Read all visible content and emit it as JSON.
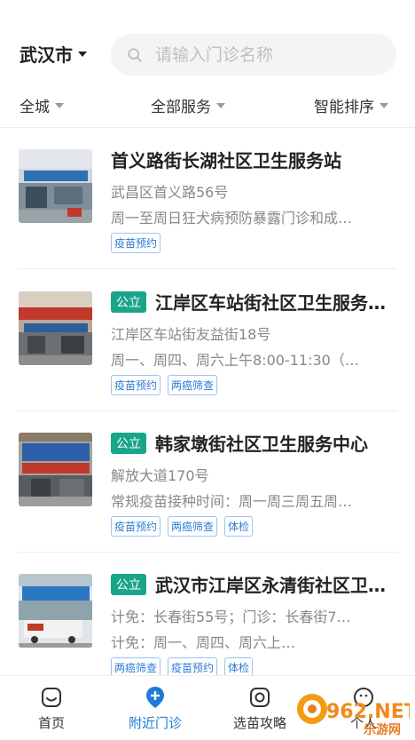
{
  "header": {
    "city": "武汉市",
    "search_placeholder": "请输入门诊名称"
  },
  "filters": {
    "area": "全城",
    "service": "全部服务",
    "sort": "智能排序"
  },
  "clinics": [
    {
      "public_badge": "",
      "name": "首义路街长湖社区卫生服务站",
      "address": "武昌区首义路56号",
      "hours": "周一至周日狂犬病预防暴露门诊和成…",
      "tags": [
        "疫苗预约"
      ]
    },
    {
      "public_badge": "公立",
      "name": "江岸区车站街社区卫生服务…",
      "address": "江岸区车站街友益街18号",
      "hours": "周一、周四、周六上午8:00-11:30（…",
      "tags": [
        "疫苗预约",
        "两癌筛查"
      ]
    },
    {
      "public_badge": "公立",
      "name": "韩家墩街社区卫生服务中心",
      "address": "解放大道170号",
      "hours": "常规疫苗接种时间：周一周三周五周…",
      "tags": [
        "疫苗预约",
        "两癌筛查",
        "体检"
      ]
    },
    {
      "public_badge": "公立",
      "name": "武汉市江岸区永清街社区卫…",
      "address": "计免：长春街55号；门诊：长春街7…",
      "hours": "计免：周一、周四、周六上…",
      "tags": [
        "两癌筛查",
        "疫苗预约",
        "体检"
      ]
    }
  ],
  "tabbar": {
    "home": "首页",
    "nearby": "附近门诊",
    "guide": "选苗攻略",
    "mine": "个人"
  },
  "watermark": {
    "brand": "962.NET",
    "sub": "乐游网"
  },
  "colors": {
    "accent_blue": "#1f7ad8",
    "public_green": "#1aa58a",
    "tag_blue": "#2e7bd6"
  }
}
